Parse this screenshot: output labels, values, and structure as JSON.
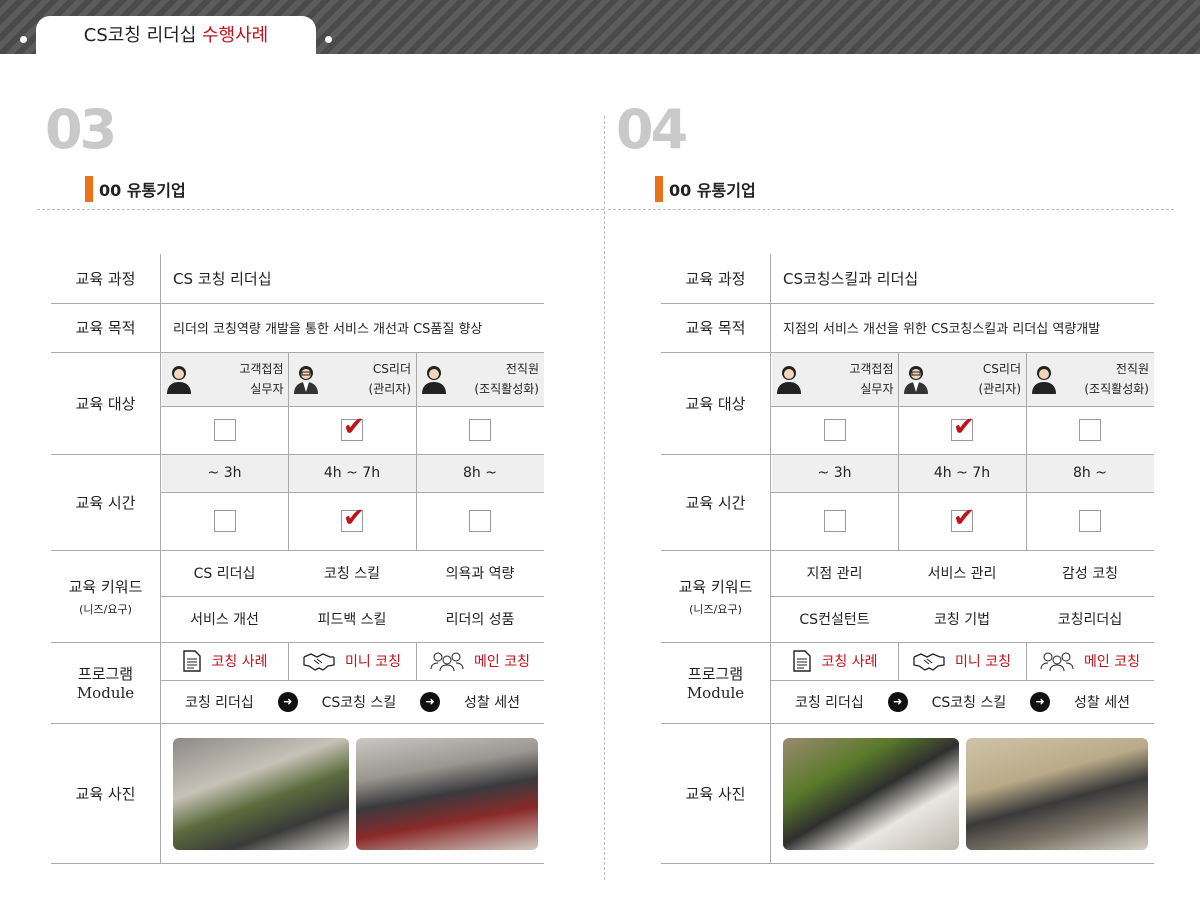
{
  "header": {
    "title_main": "CS코칭 리더십",
    "title_accent": "수행사례"
  },
  "labels": {
    "course": "교육 과정",
    "goal": "교육 목적",
    "target": "교육 대상",
    "time": "교육 시간",
    "keyword": "교육 키워드",
    "keyword_sub": "(니즈/요구)",
    "program": "프로그램",
    "program_sub": "Module",
    "photo": "교육 사진"
  },
  "targets": [
    {
      "line1": "고객접점",
      "line2": "실무자",
      "icon": "person-icon"
    },
    {
      "line1": "CS리더",
      "line2": "(관리자)",
      "icon": "manager-icon"
    },
    {
      "line1": "전직원",
      "line2": "(조직활성화)",
      "icon": "staff-icon"
    }
  ],
  "times": [
    "~ 3h",
    "4h ~ 7h",
    "8h ~"
  ],
  "modules": [
    "코칭 사례",
    "미니 코칭",
    "메인 코칭"
  ],
  "flow": [
    "코칭 리더십",
    "CS코칭 스킬",
    "성찰 세션"
  ],
  "panels": [
    {
      "number": "03",
      "company": "00 유통기업",
      "course": "CS 코칭 리더십",
      "goal": "리더의 코칭역량 개발을 통한 서비스 개선과 CS품질 향상",
      "target_checked": [
        false,
        true,
        false
      ],
      "time_checked": [
        false,
        true,
        false
      ],
      "keywords": [
        "CS 리더십",
        "코칭 스킬",
        "의욕과 역량",
        "서비스 개선",
        "피드백 스킬",
        "리더의 성품"
      ]
    },
    {
      "number": "04",
      "company": "00 유통기업",
      "course": "CS코칭스킬과 리더십",
      "goal": "지점의 서비스 개선을 위한 CS코칭스킬과 리더십 역량개발",
      "target_checked": [
        false,
        true,
        false
      ],
      "time_checked": [
        false,
        true,
        false
      ],
      "keywords": [
        "지점 관리",
        "서비스 관리",
        "감성 코칭",
        "CS컨설턴트",
        "코칭 기법",
        "코칭리더십"
      ]
    }
  ],
  "colors": {
    "accent_red": "#c0121a",
    "orange_bar": "#e8731a",
    "number_gray": "#c9c9c9"
  }
}
